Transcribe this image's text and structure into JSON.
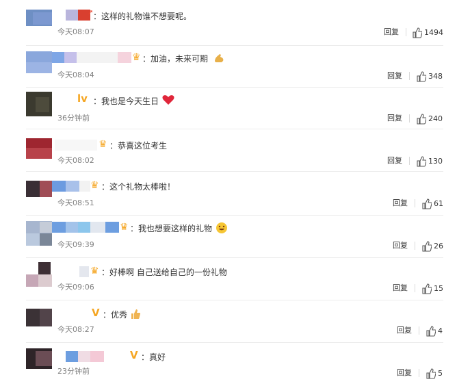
{
  "comments": [
    {
      "content": "：这样的礼物谁不想要呢。",
      "time": "今天08:07",
      "reply": "回复",
      "likes": "1494",
      "badge": "arrow",
      "emoji": ""
    },
    {
      "content": "：加油，未来可期",
      "time": "今天08:04",
      "reply": "回复",
      "likes": "348",
      "badge": "crown",
      "emoji": "muscle"
    },
    {
      "content": "：我也是今天生日",
      "time": "36分钟前",
      "reply": "回复",
      "likes": "240",
      "badge": "lv",
      "emoji": "heart"
    },
    {
      "content": "：恭喜这位考生",
      "time": "今天08:02",
      "reply": "回复",
      "likes": "130",
      "badge": "crown",
      "emoji": ""
    },
    {
      "content": "：这个礼物太棒啦！",
      "time": "今天08:51",
      "reply": "回复",
      "likes": "61",
      "badge": "crown",
      "emoji": ""
    },
    {
      "content": "：我也想要这样的礼物",
      "time": "今天09:39",
      "reply": "回复",
      "likes": "26",
      "badge": "crown",
      "emoji": "smile"
    },
    {
      "content": "：好棒啊 自己送给自己的一份礼物",
      "time": "今天09:06",
      "reply": "回复",
      "likes": "15",
      "badge": "crown",
      "emoji": ""
    },
    {
      "content": "：优秀",
      "time": "今天08:27",
      "reply": "回复",
      "likes": "4",
      "badge": "v",
      "emoji": "thumb"
    },
    {
      "content": "：真好",
      "time": "23分钟前",
      "reply": "回复",
      "likes": "5",
      "badge": "v",
      "emoji": ""
    }
  ],
  "colors": {
    "time": "#808080",
    "badge_gold": "#f5a623",
    "heart": "#e0263a",
    "link": "#333333"
  }
}
